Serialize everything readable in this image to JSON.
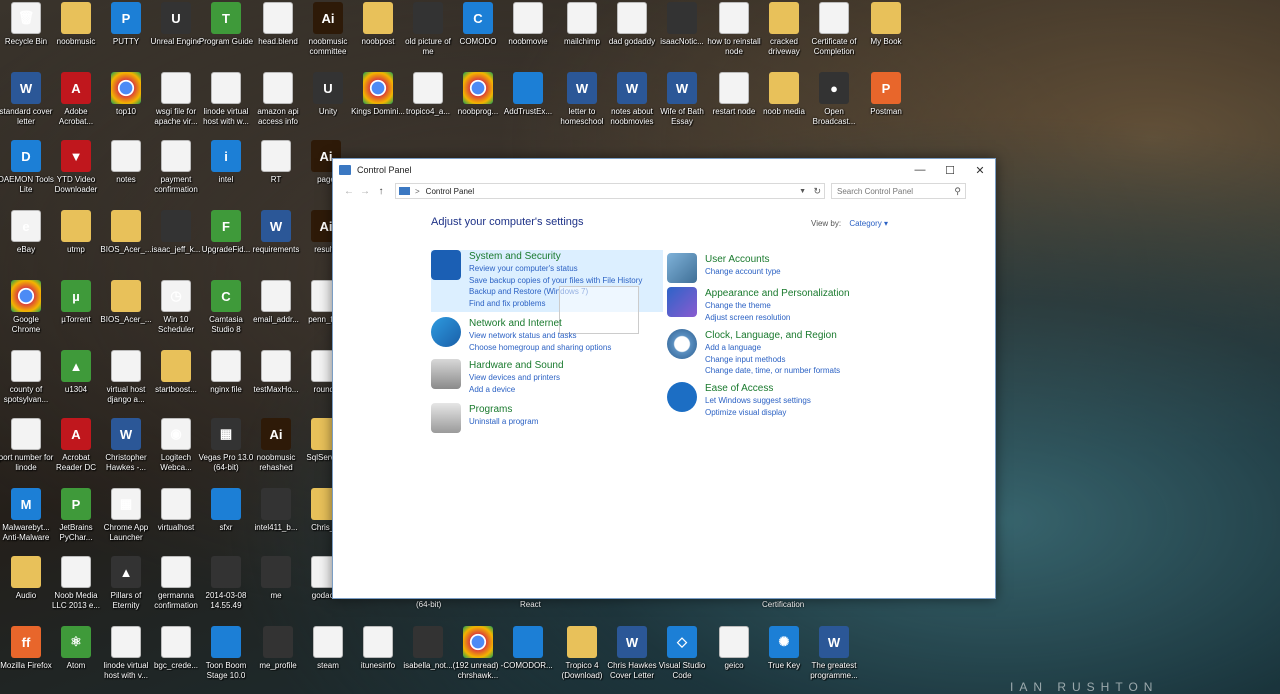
{
  "desktop_icons": [
    {
      "label": "Recycle Bin",
      "kind": "doc",
      "glyph": "🗑"
    },
    {
      "label": "noobmusic",
      "kind": "folder",
      "glyph": ""
    },
    {
      "label": "PUTTY",
      "kind": "blue",
      "glyph": "P"
    },
    {
      "label": "Unreal Engine",
      "kind": "dark",
      "glyph": "U"
    },
    {
      "label": "Program Guide",
      "kind": "green",
      "glyph": "T"
    },
    {
      "label": "head.blend",
      "kind": "doc",
      "glyph": ""
    },
    {
      "label": "noobmusic committee",
      "kind": "ai",
      "glyph": "Ai"
    },
    {
      "label": "noobpost",
      "kind": "folder",
      "glyph": ""
    },
    {
      "label": "old picture of me",
      "kind": "dark",
      "glyph": ""
    },
    {
      "label": "COMODO",
      "kind": "blue",
      "glyph": "C"
    },
    {
      "label": "noobmovie",
      "kind": "doc",
      "glyph": ""
    },
    {
      "label": "mailchimp",
      "kind": "doc",
      "glyph": ""
    },
    {
      "label": "dad godaddy",
      "kind": "doc",
      "glyph": ""
    },
    {
      "label": "isaacNotic...",
      "kind": "dark",
      "glyph": ""
    },
    {
      "label": "how to reinstall node",
      "kind": "doc",
      "glyph": ""
    },
    {
      "label": "cracked driveway",
      "kind": "folder",
      "glyph": ""
    },
    {
      "label": "Certificate of Completion",
      "kind": "doc",
      "glyph": ""
    },
    {
      "label": "My Book",
      "kind": "folder",
      "glyph": ""
    },
    {
      "label": "standard cover letter",
      "kind": "word",
      "glyph": "W"
    },
    {
      "label": "Adobe Acrobat...",
      "kind": "pdf",
      "glyph": "A"
    },
    {
      "label": "top10",
      "kind": "chrome",
      "glyph": ""
    },
    {
      "label": "wsgi file for apache vir...",
      "kind": "doc",
      "glyph": ""
    },
    {
      "label": "linode virtual host with w...",
      "kind": "doc",
      "glyph": ""
    },
    {
      "label": "amazon api access info",
      "kind": "doc",
      "glyph": ""
    },
    {
      "label": "Unity",
      "kind": "dark",
      "glyph": "U"
    },
    {
      "label": "Kings Domini...",
      "kind": "chrome",
      "glyph": ""
    },
    {
      "label": "tropico4_a...",
      "kind": "doc",
      "glyph": ""
    },
    {
      "label": "noobprog...",
      "kind": "chrome",
      "glyph": ""
    },
    {
      "label": "AddTrustEx...",
      "kind": "blue",
      "glyph": ""
    },
    {
      "label": "letter to homeschool",
      "kind": "word",
      "glyph": "W"
    },
    {
      "label": "notes about noobmovies",
      "kind": "word",
      "glyph": "W"
    },
    {
      "label": "Wife of Bath Essay",
      "kind": "word",
      "glyph": "W"
    },
    {
      "label": "restart node",
      "kind": "doc",
      "glyph": ""
    },
    {
      "label": "noob media",
      "kind": "folder",
      "glyph": ""
    },
    {
      "label": "Open Broadcast...",
      "kind": "dark",
      "glyph": "●"
    },
    {
      "label": "Postman",
      "kind": "orange",
      "glyph": "P"
    },
    {
      "label": "DAEMON Tools Lite",
      "kind": "blue",
      "glyph": "D"
    },
    {
      "label": "YTD Video Downloader",
      "kind": "pdf",
      "glyph": "▼"
    },
    {
      "label": "notes",
      "kind": "doc",
      "glyph": ""
    },
    {
      "label": "payment confirmation",
      "kind": "doc",
      "glyph": ""
    },
    {
      "label": "intel",
      "kind": "blue",
      "glyph": "i"
    },
    {
      "label": "RT",
      "kind": "doc",
      "glyph": ""
    },
    {
      "label": "page",
      "kind": "ai",
      "glyph": "Ai"
    },
    {
      "label": "eBay",
      "kind": "doc",
      "glyph": "e"
    },
    {
      "label": "utmp",
      "kind": "folder",
      "glyph": ""
    },
    {
      "label": "BIOS_Acer_...",
      "kind": "folder",
      "glyph": ""
    },
    {
      "label": "isaac_jeff_k...",
      "kind": "dark",
      "glyph": ""
    },
    {
      "label": "UpgradeFid...",
      "kind": "green",
      "glyph": "F"
    },
    {
      "label": "requirements",
      "kind": "word",
      "glyph": "W"
    },
    {
      "label": "results",
      "kind": "ai",
      "glyph": "Ai"
    },
    {
      "label": "Google Chrome",
      "kind": "chrome",
      "glyph": ""
    },
    {
      "label": "µTorrent",
      "kind": "green",
      "glyph": "µ"
    },
    {
      "label": "BIOS_Acer_...",
      "kind": "folder",
      "glyph": ""
    },
    {
      "label": "Win 10 Scheduler",
      "kind": "doc",
      "glyph": "◷"
    },
    {
      "label": "Camtasia Studio 8",
      "kind": "green",
      "glyph": "C"
    },
    {
      "label": "email_addr...",
      "kind": "doc",
      "glyph": ""
    },
    {
      "label": "penn_fo...",
      "kind": "doc",
      "glyph": ""
    },
    {
      "label": "county of spotsylvan...",
      "kind": "doc",
      "glyph": ""
    },
    {
      "label": "u1304",
      "kind": "green",
      "glyph": "▲"
    },
    {
      "label": "virtual host django a...",
      "kind": "doc",
      "glyph": ""
    },
    {
      "label": "startboost...",
      "kind": "folder",
      "glyph": ""
    },
    {
      "label": "nginx file",
      "kind": "doc",
      "glyph": ""
    },
    {
      "label": "testMaxHo...",
      "kind": "doc",
      "glyph": ""
    },
    {
      "label": "round_",
      "kind": "doc",
      "glyph": ""
    },
    {
      "label": "port number for linode",
      "kind": "doc",
      "glyph": ""
    },
    {
      "label": "Acrobat Reader DC",
      "kind": "pdf",
      "glyph": "A"
    },
    {
      "label": "Christopher Hawkes -...",
      "kind": "word",
      "glyph": "W"
    },
    {
      "label": "Logitech Webca...",
      "kind": "doc",
      "glyph": "◉"
    },
    {
      "label": "Vegas Pro 13.0 (64-bit)",
      "kind": "dark",
      "glyph": "▦"
    },
    {
      "label": "noobmusic rehashed",
      "kind": "ai",
      "glyph": "Ai"
    },
    {
      "label": "SqlServe...",
      "kind": "folder",
      "glyph": ""
    },
    {
      "label": "Malwarebyt... Anti-Malware",
      "kind": "blue",
      "glyph": "M"
    },
    {
      "label": "JetBrains PyChar...",
      "kind": "green",
      "glyph": "P"
    },
    {
      "label": "Chrome App Launcher",
      "kind": "doc",
      "glyph": "▦"
    },
    {
      "label": "virtualhost",
      "kind": "doc",
      "glyph": ""
    },
    {
      "label": "sfxr",
      "kind": "blue",
      "glyph": ""
    },
    {
      "label": "intel411_b...",
      "kind": "dark",
      "glyph": ""
    },
    {
      "label": "Chris_...",
      "kind": "folder",
      "glyph": ""
    },
    {
      "label": "Audio",
      "kind": "folder",
      "glyph": ""
    },
    {
      "label": "Noob Media LLC 2013 e...",
      "kind": "doc",
      "glyph": ""
    },
    {
      "label": "Pillars of Eternity",
      "kind": "dark",
      "glyph": "▲"
    },
    {
      "label": "germanna confirmation",
      "kind": "doc",
      "glyph": ""
    },
    {
      "label": "2014-03-08 14.55.49",
      "kind": "dark",
      "glyph": ""
    },
    {
      "label": "me",
      "kind": "dark",
      "glyph": ""
    },
    {
      "label": "godac...",
      "kind": "doc",
      "glyph": ""
    },
    {
      "label": "Mozilla Firefox",
      "kind": "orange",
      "glyph": "ff"
    },
    {
      "label": "Atom",
      "kind": "green",
      "glyph": "⚛"
    },
    {
      "label": "linode virtual host with v...",
      "kind": "doc",
      "glyph": ""
    },
    {
      "label": "bgc_crede...",
      "kind": "doc",
      "glyph": ""
    },
    {
      "label": "Toon Boom Stage 10.0",
      "kind": "blue",
      "glyph": ""
    },
    {
      "label": "me_profile",
      "kind": "dark",
      "glyph": ""
    },
    {
      "label": "steam",
      "kind": "doc",
      "glyph": ""
    },
    {
      "label": "itunesinfo",
      "kind": "doc",
      "glyph": ""
    },
    {
      "label": "isabella_not...",
      "kind": "dark",
      "glyph": ""
    },
    {
      "label": "(192 unread) - chrshawk...",
      "kind": "chrome",
      "glyph": ""
    },
    {
      "label": "COMODOR...",
      "kind": "blue",
      "glyph": ""
    },
    {
      "label": "Tropico 4 (Download)",
      "kind": "folder",
      "glyph": ""
    },
    {
      "label": "Chris Hawkes Cover Letter",
      "kind": "word",
      "glyph": "W"
    },
    {
      "label": "Visual Studio Code",
      "kind": "blue",
      "glyph": "◇"
    },
    {
      "label": "geico",
      "kind": "doc",
      "glyph": ""
    },
    {
      "label": "True Key",
      "kind": "blue",
      "glyph": "✺"
    },
    {
      "label": "The greatest programme...",
      "kind": "word",
      "glyph": "W"
    }
  ],
  "desktop_strip_labels": [
    {
      "label": "(64-bit)"
    },
    {
      "label": "React"
    },
    {
      "label": "Certification"
    }
  ],
  "window": {
    "title": "Control Panel",
    "minimize": "—",
    "maximize": "☐",
    "close": "✕",
    "nav_back": "←",
    "nav_forward": "→",
    "nav_up": "↑",
    "breadcrumb": "Control Panel",
    "breadcrumb_sep": ">",
    "search_placeholder": "Search Control Panel",
    "heading": "Adjust your computer's settings",
    "view_by_label": "View by:",
    "view_by_value": "Category ▾"
  },
  "categories_left": [
    {
      "title": "System and Security",
      "links": [
        "Review your computer's status",
        "Save backup copies of your files with File History",
        "Backup and Restore (Windows 7)",
        "Find and fix problems"
      ]
    },
    {
      "title": "Network and Internet",
      "links": [
        "View network status and tasks",
        "Choose homegroup and sharing options"
      ]
    },
    {
      "title": "Hardware and Sound",
      "links": [
        "View devices and printers",
        "Add a device"
      ]
    },
    {
      "title": "Programs",
      "links": [
        "Uninstall a program"
      ]
    }
  ],
  "categories_right": [
    {
      "title": "User Accounts",
      "links": [
        "Change account type"
      ]
    },
    {
      "title": "Appearance and Personalization",
      "links": [
        "Change the theme",
        "Adjust screen resolution"
      ]
    },
    {
      "title": "Clock, Language, and Region",
      "links": [
        "Add a language",
        "Change input methods",
        "Change date, time, or number formats"
      ]
    },
    {
      "title": "Ease of Access",
      "links": [
        "Let Windows suggest settings",
        "Optimize visual display"
      ]
    }
  ],
  "watermark": "IAN RUSHTON",
  "colors": {
    "link": "#2c62c4",
    "category_title": "#1a7a2e",
    "heading": "#1e3287"
  }
}
